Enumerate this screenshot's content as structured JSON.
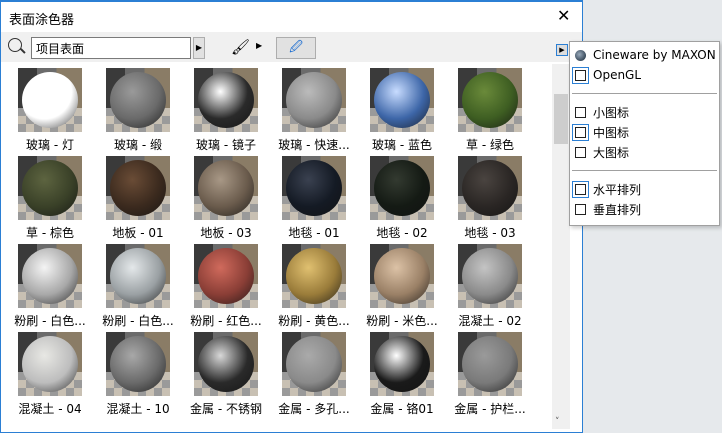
{
  "window": {
    "title": "表面涂色器",
    "close": "✕"
  },
  "toolbar": {
    "search_value": "项目表面",
    "arrow": "▶",
    "brush": "🖌",
    "picker": "🖉"
  },
  "materials": [
    {
      "label": "玻璃 - 灯",
      "color": "#ffffff",
      "hl": "#ffffff"
    },
    {
      "label": "玻璃 - 缎",
      "color": "#6a6a6a",
      "hl": "#9a9a9a"
    },
    {
      "label": "玻璃 - 镜子",
      "color": "#2a2a2a",
      "hl": "#ffffff"
    },
    {
      "label": "玻璃 - 快速...",
      "color": "#8a8a8a",
      "hl": "#bbbbbb"
    },
    {
      "label": "玻璃 - 蓝色",
      "color": "#3d66a8",
      "hl": "#c8dcff"
    },
    {
      "label": "草 - 绿色",
      "color": "#3e5e22",
      "hl": "#6a8a3a"
    },
    {
      "label": "草 - 棕色",
      "color": "#3a4128",
      "hl": "#5d6440"
    },
    {
      "label": "地板 - 01",
      "color": "#3b2a1e",
      "hl": "#6a4c36"
    },
    {
      "label": "地板 - 03",
      "color": "#6a5b4c",
      "hl": "#a89886"
    },
    {
      "label": "地毯 - 01",
      "color": "#141a24",
      "hl": "#3a4150"
    },
    {
      "label": "地毯 - 02",
      "color": "#141a14",
      "hl": "#333a30"
    },
    {
      "label": "地毯 - 03",
      "color": "#2a2624",
      "hl": "#4a4440"
    },
    {
      "label": "粉刷 - 白色...",
      "color": "#a8a8a8",
      "hl": "#f4f4f4"
    },
    {
      "label": "粉刷 - 白色...",
      "color": "#9aa0a3",
      "hl": "#e4e8ea"
    },
    {
      "label": "粉刷 - 红色...",
      "color": "#8a3e36",
      "hl": "#d06a5c"
    },
    {
      "label": "粉刷 - 黄色...",
      "color": "#9a7c3a",
      "hl": "#e0c070"
    },
    {
      "label": "粉刷 - 米色...",
      "color": "#9a8066",
      "hl": "#dcc2a6"
    },
    {
      "label": "混凝土 - 02",
      "color": "#8a8a8a",
      "hl": "#c4c4c4"
    },
    {
      "label": "混凝土 - 04",
      "color": "#bdbdbd",
      "hl": "#e8e8e4"
    },
    {
      "label": "混凝土 - 10",
      "color": "#6a6a6a",
      "hl": "#a8a8a8"
    },
    {
      "label": "金属 - 不锈钢",
      "color": "#2a2a2a",
      "hl": "#d8d8d8"
    },
    {
      "label": "金属 - 多孔...",
      "color": "#8a8a8a",
      "hl": "#aaaaaa"
    },
    {
      "label": "金属 - 铬01",
      "color": "#1a1a1a",
      "hl": "#ffffff"
    },
    {
      "label": "金属 - 护栏...",
      "color": "#7a7a7a",
      "hl": "#9a9a9a"
    }
  ],
  "menu": {
    "renderers": [
      {
        "label": "Cineware by MAXON",
        "selected": false
      },
      {
        "label": "OpenGL",
        "selected": true
      }
    ],
    "views": [
      {
        "label": "小图标",
        "selected": false
      },
      {
        "label": "中图标",
        "selected": true
      },
      {
        "label": "大图标",
        "selected": false
      }
    ],
    "layouts": [
      {
        "label": "水平排列",
        "selected": true
      },
      {
        "label": "垂直排列",
        "selected": false
      }
    ]
  },
  "scrollbar": {
    "down": "˅"
  }
}
